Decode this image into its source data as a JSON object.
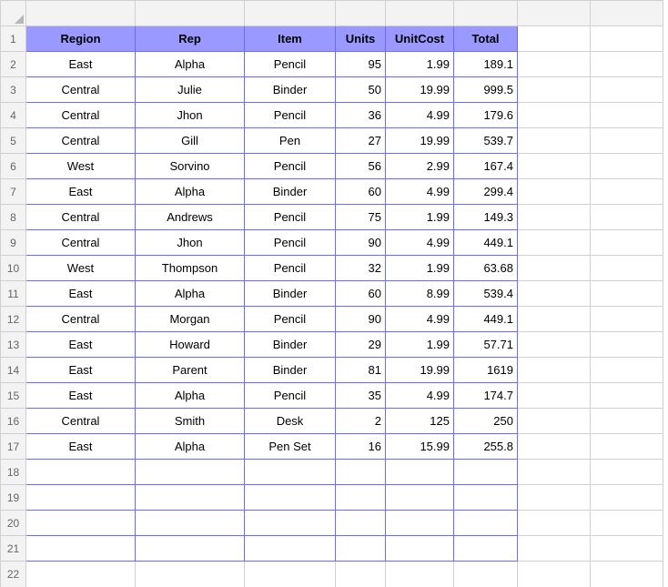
{
  "chart_data": {
    "type": "table",
    "columns": [
      "Region",
      "Rep",
      "Item",
      "Units",
      "UnitCost",
      "Total"
    ],
    "rows": [
      [
        "East",
        "Alpha",
        "Pencil",
        95,
        1.99,
        189.1
      ],
      [
        "Central",
        "Julie",
        "Binder",
        50,
        19.99,
        999.5
      ],
      [
        "Central",
        "Jhon",
        "Pencil",
        36,
        4.99,
        179.6
      ],
      [
        "Central",
        "Gill",
        "Pen",
        27,
        19.99,
        539.7
      ],
      [
        "West",
        "Sorvino",
        "Pencil",
        56,
        2.99,
        167.4
      ],
      [
        "East",
        "Alpha",
        "Binder",
        60,
        4.99,
        299.4
      ],
      [
        "Central",
        "Andrews",
        "Pencil",
        75,
        1.99,
        149.3
      ],
      [
        "Central",
        "Jhon",
        "Pencil",
        90,
        4.99,
        449.1
      ],
      [
        "West",
        "Thompson",
        "Pencil",
        32,
        1.99,
        63.68
      ],
      [
        "East",
        "Alpha",
        "Binder",
        60,
        8.99,
        539.4
      ],
      [
        "Central",
        "Morgan",
        "Pencil",
        90,
        4.99,
        449.1
      ],
      [
        "East",
        "Howard",
        "Binder",
        29,
        1.99,
        57.71
      ],
      [
        "East",
        "Parent",
        "Binder",
        81,
        19.99,
        1619
      ],
      [
        "East",
        "Alpha",
        "Pencil",
        35,
        4.99,
        174.7
      ],
      [
        "Central",
        "Smith",
        "Desk",
        2,
        125,
        250
      ],
      [
        "East",
        "Alpha",
        "Pen Set",
        16,
        15.99,
        255.8
      ]
    ]
  },
  "row_numbers": [
    "1",
    "2",
    "3",
    "4",
    "5",
    "6",
    "7",
    "8",
    "9",
    "10",
    "11",
    "12",
    "13",
    "14",
    "15",
    "16",
    "17",
    "18",
    "19",
    "20",
    "21",
    "22"
  ],
  "empty_data_rows": 4
}
